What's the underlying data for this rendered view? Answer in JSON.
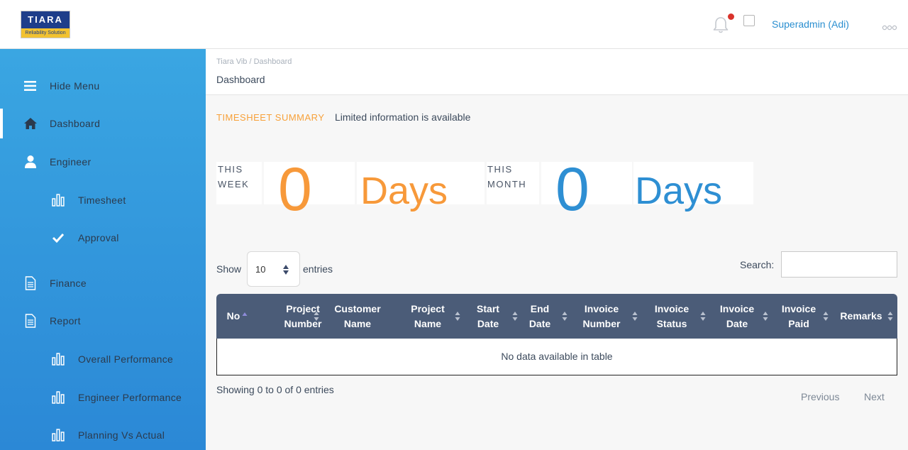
{
  "header": {
    "logo_title": "TIARA",
    "logo_tagline": "Reliability Solution",
    "user_name": "Superadmin (Adi)"
  },
  "sidebar": {
    "items": [
      {
        "label": "Hide Menu",
        "icon": "hamburger-icon"
      },
      {
        "label": "Dashboard",
        "icon": "home-icon",
        "active": true
      },
      {
        "label": "Engineer",
        "icon": "user-icon"
      },
      {
        "label": "Timesheet",
        "icon": "bar-chart-icon"
      },
      {
        "label": "Approval",
        "icon": "check-icon"
      },
      {
        "label": "Finance",
        "icon": "document-icon"
      },
      {
        "label": "Report",
        "icon": "document-icon"
      },
      {
        "label": "Overall Performance",
        "icon": "bar-chart-icon"
      },
      {
        "label": "Engineer Performance",
        "icon": "bar-chart-icon"
      },
      {
        "label": "Planning Vs Actual",
        "icon": "bar-chart-icon"
      }
    ]
  },
  "breadcrumb": {
    "path": "Tiara Vib / Dashboard",
    "title": "Dashboard"
  },
  "summary": {
    "label": "TIMESHEET SUMMARY",
    "info": "Limited information is available",
    "week": {
      "line1": "THIS",
      "line2": "WEEK",
      "value": "0",
      "unit": "Days",
      "color": "#f7993a"
    },
    "month": {
      "line1": "THIS",
      "line2": "MONTH",
      "value": "0",
      "unit": "Days",
      "color": "#2e8fd3"
    }
  },
  "table_controls": {
    "show_label": "Show",
    "length_value": "10",
    "entries_label": "entries",
    "search_label": "Search:",
    "search_value": ""
  },
  "table": {
    "columns": [
      {
        "line1": "No",
        "line2": ""
      },
      {
        "line1": "Project",
        "line2": "Number"
      },
      {
        "line1": "Customer",
        "line2": "Name"
      },
      {
        "line1": "Project",
        "line2": "Name"
      },
      {
        "line1": "Start",
        "line2": "Date"
      },
      {
        "line1": "End",
        "line2": "Date"
      },
      {
        "line1": "Invoice",
        "line2": "Number"
      },
      {
        "line1": "Invoice",
        "line2": "Status"
      },
      {
        "line1": "Invoice",
        "line2": "Date"
      },
      {
        "line1": "Invoice",
        "line2": "Paid"
      },
      {
        "line1": "Remarks",
        "line2": ""
      }
    ],
    "empty_message": "No data available in table",
    "info": "Showing 0 to 0 of 0 entries",
    "previous": "Previous",
    "next": "Next"
  },
  "colors": {
    "sidebar_top": "#3aa6e2",
    "sidebar_bottom": "#2b88d6",
    "table_header": "#4b5c78",
    "accent_orange": "#f7993a",
    "accent_blue": "#2e8fd3"
  }
}
